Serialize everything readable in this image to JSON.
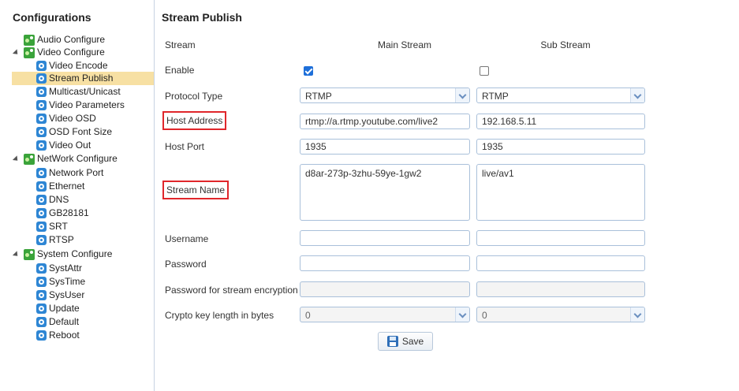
{
  "sidebar": {
    "title": "Configurations",
    "items": [
      {
        "label": "Audio Configure"
      },
      {
        "label": "Video Configure"
      },
      {
        "label": "Video Encode"
      },
      {
        "label": "Stream Publish"
      },
      {
        "label": "Multicast/Unicast"
      },
      {
        "label": "Video Parameters"
      },
      {
        "label": "Video OSD"
      },
      {
        "label": "OSD Font Size"
      },
      {
        "label": "Video Out"
      },
      {
        "label": "NetWork Configure"
      },
      {
        "label": "Network Port"
      },
      {
        "label": "Ethernet"
      },
      {
        "label": "DNS"
      },
      {
        "label": "GB28181"
      },
      {
        "label": "SRT"
      },
      {
        "label": "RTSP"
      },
      {
        "label": "System Configure"
      },
      {
        "label": "SystAttr"
      },
      {
        "label": "SysTime"
      },
      {
        "label": "SysUser"
      },
      {
        "label": "Update"
      },
      {
        "label": "Default"
      },
      {
        "label": "Reboot"
      }
    ]
  },
  "main": {
    "title": "Stream Publish",
    "labels": {
      "stream": "Stream",
      "enable": "Enable",
      "protocol": "Protocol Type",
      "host_address": "Host Address",
      "host_port": "Host Port",
      "stream_name": "Stream Name",
      "username": "Username",
      "password": "Password",
      "enc_password": "Password for stream encryption",
      "crypto_len": "Crypto key length in bytes"
    },
    "main_stream": {
      "header": "Main Stream",
      "enabled": true,
      "protocol": "RTMP",
      "host_address": "rtmp://a.rtmp.youtube.com/live2",
      "host_port": "1935",
      "stream_name": "d8ar-273p-3zhu-59ye-1gw2",
      "username": "",
      "password": "",
      "enc_password": "",
      "crypto_len": "0"
    },
    "sub_stream": {
      "header": "Sub Stream",
      "enabled": false,
      "protocol": "RTMP",
      "host_address": "192.168.5.11",
      "host_port": "1935",
      "stream_name": "live/av1",
      "username": "",
      "password": "",
      "enc_password": "",
      "crypto_len": "0"
    },
    "save_label": "Save"
  },
  "colors": {
    "selected": "#f7e0a3",
    "highlight": "#e0262b",
    "folder_icon": "#3aa33a",
    "item_icon": "#2e86d4"
  }
}
